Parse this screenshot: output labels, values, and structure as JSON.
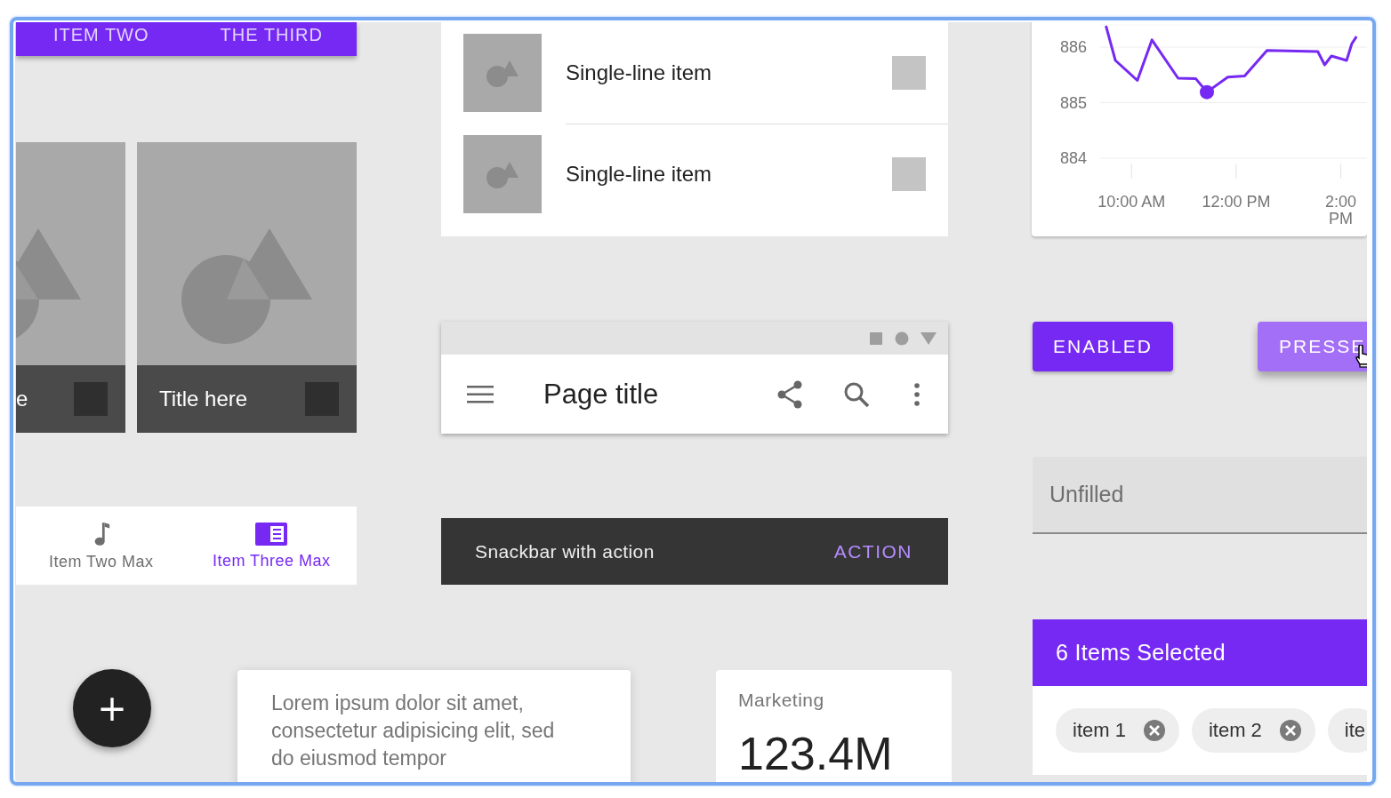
{
  "tab_bar": {
    "tabs": [
      {
        "label": "ITEM TWO"
      },
      {
        "label": "THE THIRD"
      }
    ]
  },
  "image_tiles": [
    {
      "title": "e"
    },
    {
      "title": "Title here"
    }
  ],
  "bottom_nav": [
    {
      "label": "Item Two Max",
      "kind": "note",
      "selected": false
    },
    {
      "label": "Item Three Max",
      "kind": "list",
      "selected": true
    }
  ],
  "fab": {
    "label": "+"
  },
  "text_card": {
    "text": "Lorem ipsum dolor sit amet, consectetur adipisicing elit, sed do eiusmod tempor"
  },
  "stat_card": {
    "label": "Marketing",
    "value": "123.4M"
  },
  "list": [
    {
      "text": "Single-line item"
    },
    {
      "text": "Single-line item"
    }
  ],
  "app_bar": {
    "title": "Page title"
  },
  "snackbar": {
    "message": "Snackbar with action",
    "action": "ACTION"
  },
  "chart": {
    "chart_data": {
      "type": "line",
      "x": [
        9.51,
        9.69,
        10.11,
        10.39,
        10.89,
        11.23,
        11.44,
        11.84,
        12.16,
        12.59,
        13.56,
        13.69,
        13.82,
        14.11,
        14.21,
        14.3
      ],
      "series": [
        {
          "color": "#7629f3",
          "values": [
            886.38,
            885.76,
            885.4,
            886.13,
            885.44,
            885.43,
            885.19,
            885.46,
            885.48,
            885.94,
            885.92,
            885.68,
            885.84,
            885.76,
            886.06,
            886.19
          ]
        }
      ],
      "grid": true,
      "xlim": [
        9.4,
        14.5
      ],
      "ylim": [
        884,
        886.4
      ],
      "xticks": [
        {
          "value": 10,
          "label": "10:00 AM"
        },
        {
          "value": 12,
          "label": "12:00 PM"
        },
        {
          "value": 14,
          "label": "2:00 PM"
        }
      ],
      "yticks": [
        884,
        885,
        886
      ]
    }
  },
  "buttons": [
    {
      "label": "ENABLED",
      "kind": "enabled"
    },
    {
      "label": "PRESSE",
      "kind": "pressed"
    }
  ],
  "text_field": {
    "placeholder": "Unfilled"
  },
  "selection_bar": {
    "title": "6 Items Selected"
  },
  "chips": [
    {
      "label": "item 1",
      "removable": true
    },
    {
      "label": "item 2",
      "removable": true
    },
    {
      "label": "ite",
      "removable": false
    }
  ]
}
